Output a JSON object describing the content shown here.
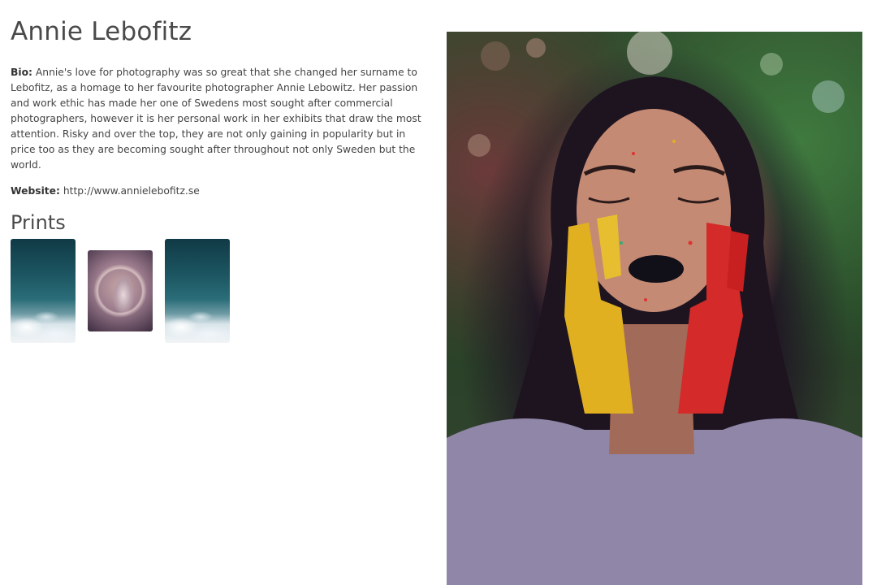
{
  "artist": {
    "name": "Annie Lebofitz",
    "bio_label": "Bio:",
    "bio_text": " Annie's love for photography was so great that she changed her surname to Lebofitz, as a homage to her favourite photographer Annie Lebowitz. Her passion and work ethic has made her one of Swedens most sought after commercial photographers, however it is her personal work in her exhibits that draw the most attention. Risky and over the top, they are not only gaining in popularity but in price too as they are becoming sought after throughout not only Sweden but the world.",
    "website_label": "Website:",
    "website_url": "http://www.annielebofitz.se"
  },
  "prints": {
    "heading": "Prints",
    "items": [
      {
        "subject": "aerial ocean waves"
      },
      {
        "subject": "girl in bubble"
      },
      {
        "subject": "aerial ocean waves"
      }
    ]
  },
  "hero_image": {
    "subject": "woman with eyes closed, hands painted yellow and red, black lipstick"
  },
  "colors": {
    "text": "#444444",
    "heading": "#4a4a4a",
    "background": "#ffffff"
  }
}
